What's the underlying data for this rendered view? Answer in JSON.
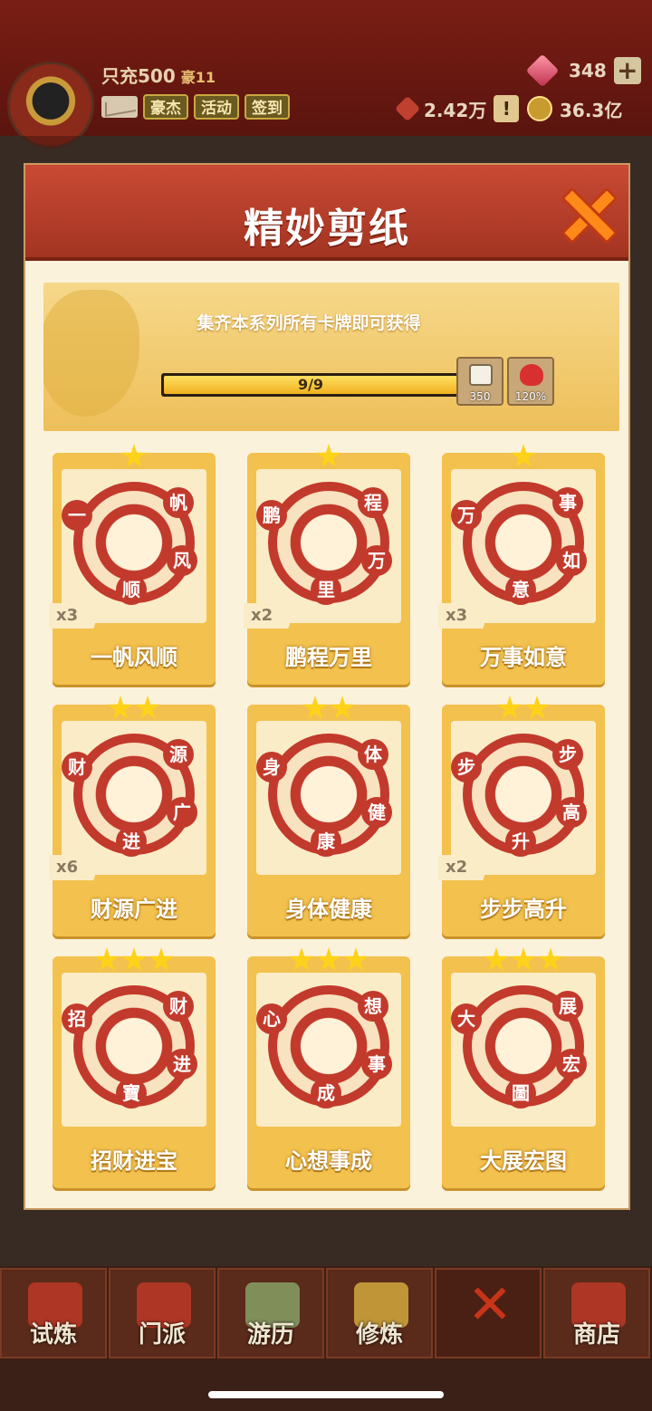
{
  "player": {
    "name": "只充500",
    "vip": "豪11"
  },
  "top_buttons": {
    "hero": "豪杰",
    "activity": "活动",
    "signin": "签到"
  },
  "resources": {
    "gems": "348",
    "prestige": "2.42万",
    "gold": "36.3亿"
  },
  "modal": {
    "title": "精妙剪纸",
    "banner_text": "集齐本系列所有卡牌即可获得",
    "progress_text": "9/9",
    "progress_fraction": 1.0,
    "rewards": [
      {
        "icon": "dice-icon",
        "value": "350"
      },
      {
        "icon": "heart-icon",
        "value": "120%"
      }
    ]
  },
  "cards": [
    {
      "name": "一帆风顺",
      "count": "x3",
      "stars": 1,
      "glyphs": [
        "一",
        "帆",
        "风",
        "顺"
      ]
    },
    {
      "name": "鹏程万里",
      "count": "x2",
      "stars": 1,
      "glyphs": [
        "鹏",
        "程",
        "万",
        "里"
      ]
    },
    {
      "name": "万事如意",
      "count": "x3",
      "stars": 1,
      "glyphs": [
        "万",
        "事",
        "如",
        "意"
      ]
    },
    {
      "name": "财源广进",
      "count": "x6",
      "stars": 2,
      "glyphs": [
        "财",
        "源",
        "广",
        "进"
      ]
    },
    {
      "name": "身体健康",
      "count": "",
      "stars": 2,
      "glyphs": [
        "身",
        "体",
        "健",
        "康"
      ]
    },
    {
      "name": "步步高升",
      "count": "x2",
      "stars": 2,
      "glyphs": [
        "步",
        "步",
        "高",
        "升"
      ]
    },
    {
      "name": "招财进宝",
      "count": "",
      "stars": 3,
      "glyphs": [
        "招",
        "财",
        "进",
        "寶"
      ]
    },
    {
      "name": "心想事成",
      "count": "",
      "stars": 3,
      "glyphs": [
        "心",
        "想",
        "事",
        "成"
      ]
    },
    {
      "name": "大展宏图",
      "count": "",
      "stars": 3,
      "glyphs": [
        "大",
        "展",
        "宏",
        "圖"
      ]
    }
  ],
  "bottom_nav": [
    "试炼",
    "门派",
    "游历",
    "修炼",
    "商店"
  ],
  "colors": {
    "paper_red": "#c23a2c",
    "card_gold": "#f3c14e",
    "header_red": "#b83c28"
  }
}
